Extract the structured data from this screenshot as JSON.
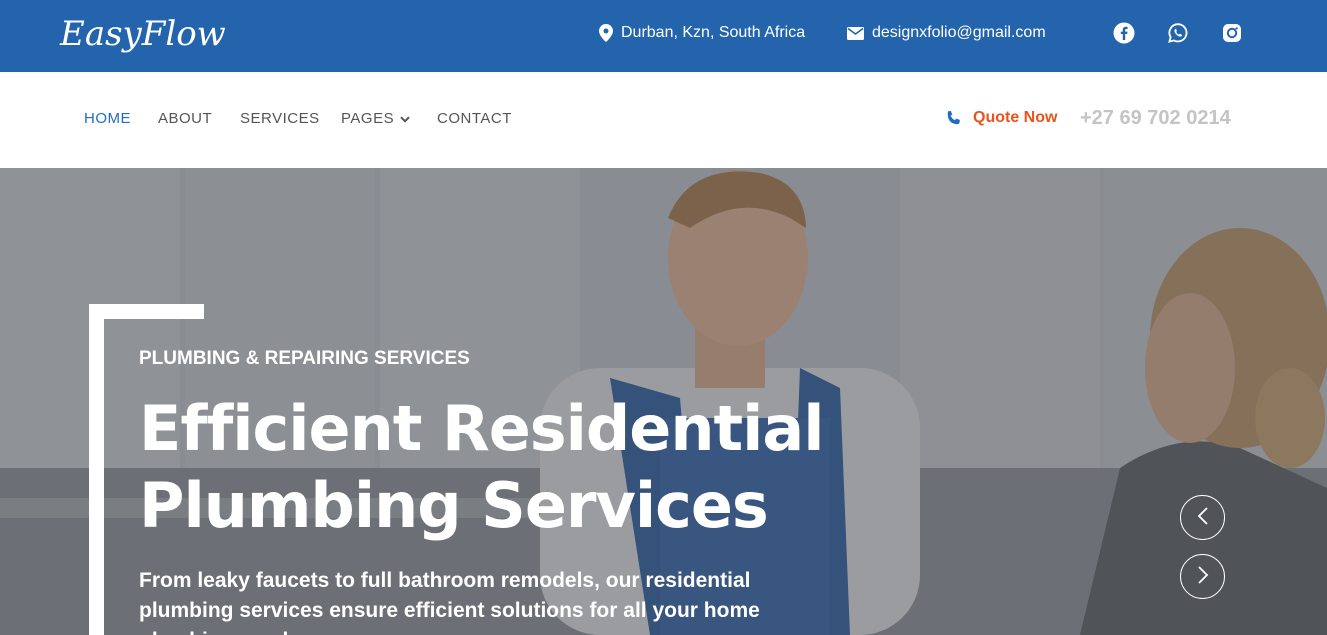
{
  "brand": {
    "logo_text": "EasyFlow"
  },
  "topbar": {
    "location": "Durban, Kzn, South Africa",
    "email": "designxfolio@gmail.com",
    "social_icons": [
      "facebook-icon",
      "whatsapp-icon",
      "instagram-icon"
    ]
  },
  "nav": {
    "items": [
      {
        "label": "HOME",
        "active": true
      },
      {
        "label": "ABOUT"
      },
      {
        "label": "SERVICES"
      },
      {
        "label": "PAGES",
        "has_dropdown": true
      },
      {
        "label": "CONTACT"
      }
    ],
    "quote_label": "Quote Now",
    "phone": "+27 69 702 0214"
  },
  "hero": {
    "tagline": "PLUMBING & REPAIRING SERVICES",
    "title_line1": "Efficient Residential",
    "title_line2": "Plumbing Services",
    "description": "From leaky faucets to full bathroom remodels, our residential plumbing services ensure efficient solutions for all your home plumbing needs."
  },
  "colors": {
    "topbar_bg": "#2464ad",
    "nav_active": "#1e6dbe",
    "quote_accent": "#e8541c",
    "phone_text": "#c4c4c4"
  }
}
